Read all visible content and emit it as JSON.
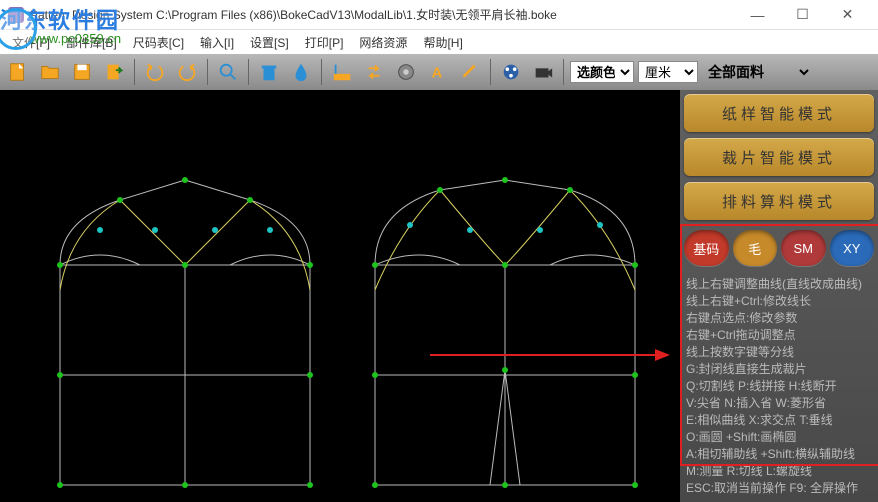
{
  "titlebar": {
    "title": "Pattern Design System    C:\\Program Files (x86)\\BokeCadV13\\ModalLib\\1.女时装\\无领平肩长袖.boke"
  },
  "watermark": {
    "line1": "河东软件园",
    "line2": "www.pc0359.cn"
  },
  "menu": {
    "file": "文件[F]",
    "parts": "部件库[B]",
    "size": "尺码表[C]",
    "input": "输入[I]",
    "settings": "设置[S]",
    "print": "打印[P]",
    "netres": "网络资源",
    "help": "帮助[H]"
  },
  "toolbar": {
    "color_select": "选颜色",
    "unit_select": "厘米",
    "material_select": "全部面料"
  },
  "sidebar": {
    "mode1": "纸样智能模式",
    "mode2": "裁片智能模式",
    "mode3": "排料算料模式",
    "pills": {
      "base": "基码",
      "hair": "毛",
      "sm": "SM",
      "xy": "XY"
    }
  },
  "help": {
    "l0": "线上右键调整曲线(直线改成曲线)",
    "l1": "线上右键+Ctrl:修改线长",
    "l2": "右键点选点:修改参数",
    "l3": "右键+Ctrl拖动调整点",
    "l4": "线上按数字键等分线",
    "l5": "G:封闭线直接生成裁片",
    "l6": "Q:切割线  P:线拼接  H:线断开",
    "l7": "V:尖省  N:插入省  W:菱形省",
    "l8": "E:相似曲线  X:求交点  T:垂线",
    "l9": "O:画圆 +Shift:画椭圆",
    "l10": "A:相切辅助线 +Shift:横纵辅助线",
    "l11": "M:测量  R:切线  L:螺旋线",
    "l12": "ESC:取消当前操作  F9: 全屏操作"
  }
}
